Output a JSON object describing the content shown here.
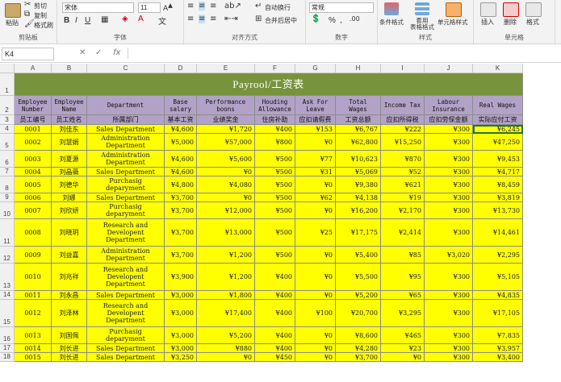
{
  "ribbon": {
    "paste": "粘贴",
    "cut": "剪切",
    "copy": "复制",
    "format_painter": "格式刷",
    "clipboard_label": "剪贴板",
    "font_name": "宋体",
    "font_size": "11",
    "font_label": "字体",
    "wrap_text": "自动换行",
    "merge_center": "合并后居中",
    "alignment_label": "对齐方式",
    "number_format": "常规",
    "number_label": "数字",
    "conditional_format": "条件格式",
    "table_format": "套用\n表格格式",
    "cell_styles": "单元格样式",
    "styles_label": "样式",
    "insert": "插入",
    "delete": "删除",
    "format": "格式",
    "cells_label": "单元格",
    "bold": "B",
    "italic": "I",
    "underline": "U",
    "percent": "%",
    "comma": ","
  },
  "formula_bar": {
    "name_box": "K4",
    "fx": "fx",
    "value": ""
  },
  "columns": [
    "A",
    "B",
    "C",
    "D",
    "E",
    "F",
    "G",
    "H",
    "I",
    "J",
    "K"
  ],
  "sheet": {
    "title": "Payrool/工资表",
    "headers_en": [
      "Employee\nNumber",
      "Employee\nName",
      "Department",
      "Base\nsalary",
      "Performance\nboons",
      "Houding\nAllowance",
      "Ask For\nLeave",
      "Total\nWages",
      "Income Tax",
      "Labour\nInsurance",
      "Real Wages"
    ],
    "headers_cn": [
      "员工编号",
      "员工姓名",
      "所属部门",
      "基本工资",
      "业绩奖金",
      "住房补助",
      "应扣请假费",
      "工资总额",
      "应扣所得税",
      "应扣劳保金额",
      "实际应付工资"
    ],
    "rows": [
      {
        "r": "4",
        "c": [
          "0001",
          "刘佳东",
          "Sales Department",
          "¥4,600",
          "¥1,720",
          "¥400",
          "¥153",
          "¥6,767",
          "¥222",
          "¥300",
          "¥6,245"
        ]
      },
      {
        "r": "5",
        "c": [
          "0002",
          "刘慧娟",
          "Administration\nDepartment",
          "¥5,000",
          "¥57,000",
          "¥800",
          "¥0",
          "¥62,800",
          "¥15,250",
          "¥300",
          "¥47,250"
        ]
      },
      {
        "r": "6",
        "c": [
          "0003",
          "刘夏源",
          "Administration\nDepartment",
          "¥4,600",
          "¥5,600",
          "¥500",
          "¥77",
          "¥10,623",
          "¥870",
          "¥300",
          "¥9,453"
        ]
      },
      {
        "r": "7",
        "c": [
          "0004",
          "刘晶薇",
          "Sales Department",
          "¥4,600",
          "¥0",
          "¥500",
          "¥31",
          "¥5,069",
          "¥52",
          "¥300",
          "¥4,717"
        ]
      },
      {
        "r": "8",
        "c": [
          "0005",
          "刘德华",
          "Purchasig\ndeparyment",
          "¥4,800",
          "¥4,080",
          "¥500",
          "¥0",
          "¥9,380",
          "¥621",
          "¥300",
          "¥8,459"
        ]
      },
      {
        "r": "9",
        "c": [
          "0006",
          "刘娜",
          "Sales Department",
          "¥3,700",
          "¥0",
          "¥500",
          "¥62",
          "¥4,138",
          "¥19",
          "¥300",
          "¥3,819"
        ]
      },
      {
        "r": "10",
        "c": [
          "0007",
          "刘欣妍",
          "Purchasig\ndeparyment",
          "¥3,700",
          "¥12,000",
          "¥500",
          "¥0",
          "¥16,200",
          "¥2,170",
          "¥300",
          "¥13,730"
        ]
      },
      {
        "r": "11",
        "c": [
          "0008",
          "刘晓玥",
          "Research and\nDevelopent\nDepartment",
          "¥3,700",
          "¥13,000",
          "¥500",
          "¥25",
          "¥17,175",
          "¥2,414",
          "¥300",
          "¥14,461"
        ]
      },
      {
        "r": "12",
        "c": [
          "0009",
          "刘益嘉",
          "Administration\nDepartment",
          "¥3,700",
          "¥1,200",
          "¥500",
          "¥0",
          "¥5,400",
          "¥85",
          "¥3,020",
          "¥2,295"
        ]
      },
      {
        "r": "13",
        "c": [
          "0010",
          "刘兆祥",
          "Research and\nDevelopent\nDepartment",
          "¥3,900",
          "¥1,200",
          "¥400",
          "¥0",
          "¥5,500",
          "¥95",
          "¥300",
          "¥5,105"
        ]
      },
      {
        "r": "14",
        "c": [
          "0011",
          "刘永昌",
          "Sales Department",
          "¥3,000",
          "¥1,800",
          "¥400",
          "¥0",
          "¥5,200",
          "¥65",
          "¥300",
          "¥4,835"
        ]
      },
      {
        "r": "15",
        "c": [
          "0012",
          "刘泽林",
          "Research and\nDevelopent\nDepartment",
          "¥3,000",
          "¥17,400",
          "¥400",
          "¥100",
          "¥20,700",
          "¥3,295",
          "¥300",
          "¥17,105"
        ]
      },
      {
        "r": "16",
        "c": [
          "0013",
          "刘国佩",
          "Purchasig\ndeparyment",
          "¥3,000",
          "¥5,200",
          "¥400",
          "¥0",
          "¥8,600",
          "¥465",
          "¥300",
          "¥7,835"
        ]
      },
      {
        "r": "17",
        "c": [
          "0014",
          "刘长进",
          "Sales Department",
          "¥3,000",
          "¥880",
          "¥400",
          "¥0",
          "¥4,280",
          "¥23",
          "¥300",
          "¥3,957"
        ]
      },
      {
        "r": "18",
        "c": [
          "0015",
          "刘长进",
          "Sales Department",
          "¥3,250",
          "¥0",
          "¥450",
          "¥0",
          "¥3,700",
          "¥0",
          "¥300",
          "¥3,400"
        ]
      }
    ]
  }
}
